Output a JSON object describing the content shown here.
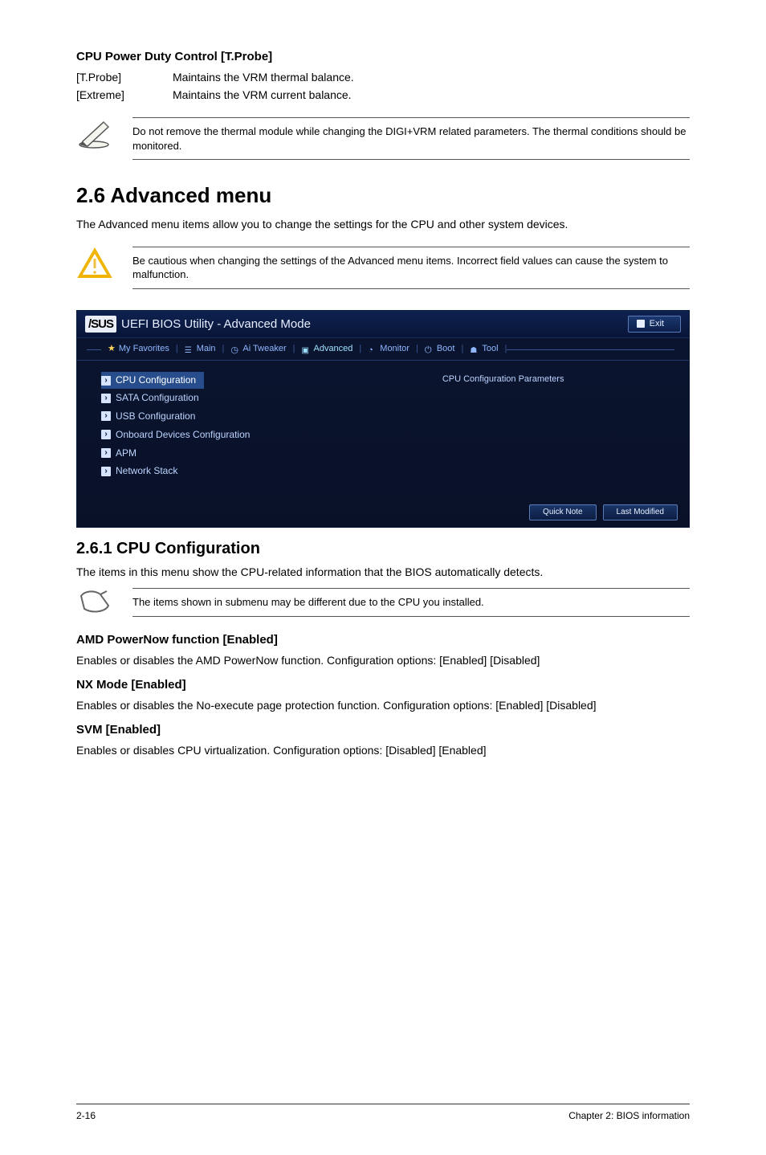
{
  "section1": {
    "heading": "CPU Power Duty Control [T.Probe]",
    "rows": [
      {
        "term": "[T.Probe]",
        "desc": "Maintains the VRM thermal balance."
      },
      {
        "term": "[Extreme]",
        "desc": "Maintains the VRM current balance."
      }
    ],
    "note": "Do not remove the thermal module while changing the DIGI+VRM related parameters. The thermal conditions should be monitored."
  },
  "section2": {
    "title": "2.6        Advanced menu",
    "intro": "The Advanced menu items allow you to change the settings for the CPU and other system devices.",
    "caution": "Be cautious when changing the settings of the Advanced menu items. Incorrect field values can cause the system to malfunction."
  },
  "bios": {
    "title": "UEFI BIOS Utility - Advanced Mode",
    "exit": "Exit",
    "tabs": {
      "fav": "My Favorites",
      "main": "Main",
      "tweaker": "Ai Tweaker",
      "advanced": "Advanced",
      "monitor": "Monitor",
      "boot": "Boot",
      "tool": "Tool"
    },
    "items": [
      "CPU Configuration",
      "SATA Configuration",
      "USB Configuration",
      "Onboard Devices Configuration",
      "APM",
      "Network Stack"
    ],
    "right_help": "CPU Configuration Parameters",
    "footer": {
      "quicknote": "Quick Note",
      "lastmod": "Last Modified"
    }
  },
  "section3": {
    "title": "2.6.1       CPU Configuration",
    "intro": "The items in this menu show the CPU-related information that the BIOS automatically detects.",
    "note": "The items shown in submenu may be different due to the CPU you installed.",
    "sub": [
      {
        "h": "AMD PowerNow function [Enabled]",
        "p": "Enables or disables the AMD PowerNow function. Configuration options: [Enabled] [Disabled]"
      },
      {
        "h": "NX Mode [Enabled]",
        "p": "Enables or disables the No-execute page protection function. Configuration options: [Enabled] [Disabled]"
      },
      {
        "h": "SVM [Enabled]",
        "p": "Enables or disables CPU virtualization. Configuration options: [Disabled] [Enabled]"
      }
    ]
  },
  "footer": {
    "left": "2-16",
    "right": "Chapter 2: BIOS information"
  }
}
